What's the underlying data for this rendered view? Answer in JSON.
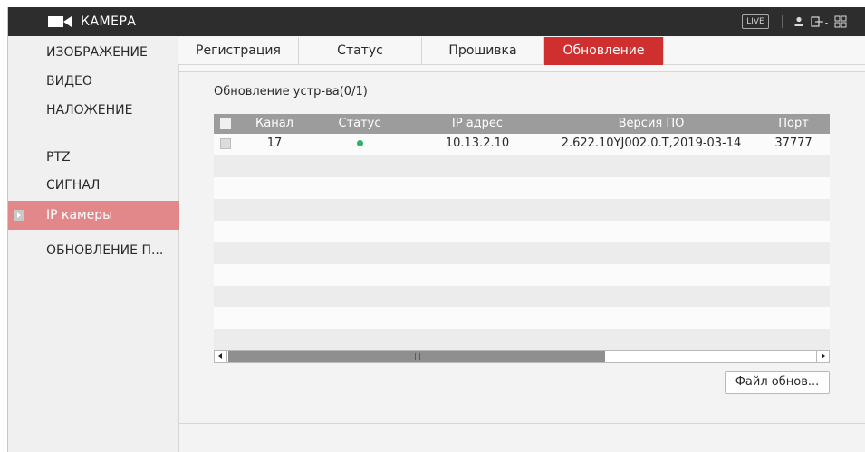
{
  "header": {
    "title": "КАМЕРА",
    "live_label": "LIVE",
    "icons": [
      "camera-icon",
      "user-icon",
      "logout-icon",
      "grid-icon"
    ]
  },
  "sidebar": {
    "items": [
      {
        "label": "ИЗОБРАЖЕНИЕ"
      },
      {
        "label": "ВИДЕО"
      },
      {
        "label": "НАЛОЖЕНИЕ"
      },
      {
        "label": "PTZ"
      },
      {
        "label": "СИГНАЛ"
      },
      {
        "label": "IP камеры",
        "active": true
      },
      {
        "label": "ОБНОВЛЕНИЕ П..."
      }
    ]
  },
  "tabs": [
    {
      "label": "Регистрация"
    },
    {
      "label": "Статус"
    },
    {
      "label": "Прошивка"
    },
    {
      "label": "Обновление",
      "active": true
    }
  ],
  "main": {
    "section_title": "Обновление устр-ва(0/1)",
    "table": {
      "headers": [
        "Канал",
        "Статус",
        "IP адрес",
        "Версия ПО",
        "Порт"
      ],
      "rows": [
        {
          "channel": "17",
          "status": "online",
          "ip": "10.13.2.10",
          "version": "2.622.10YJ002.0.T,2019-03-14",
          "port": "37777"
        }
      ]
    },
    "update_file_button": "Файл обнов..."
  },
  "colors": {
    "topbar": "#2d2d2d",
    "active_tab": "#cf2f2f",
    "active_sidebar": "#e3888a",
    "status_online": "#2ab36a",
    "table_header": "#9c9c9c"
  }
}
